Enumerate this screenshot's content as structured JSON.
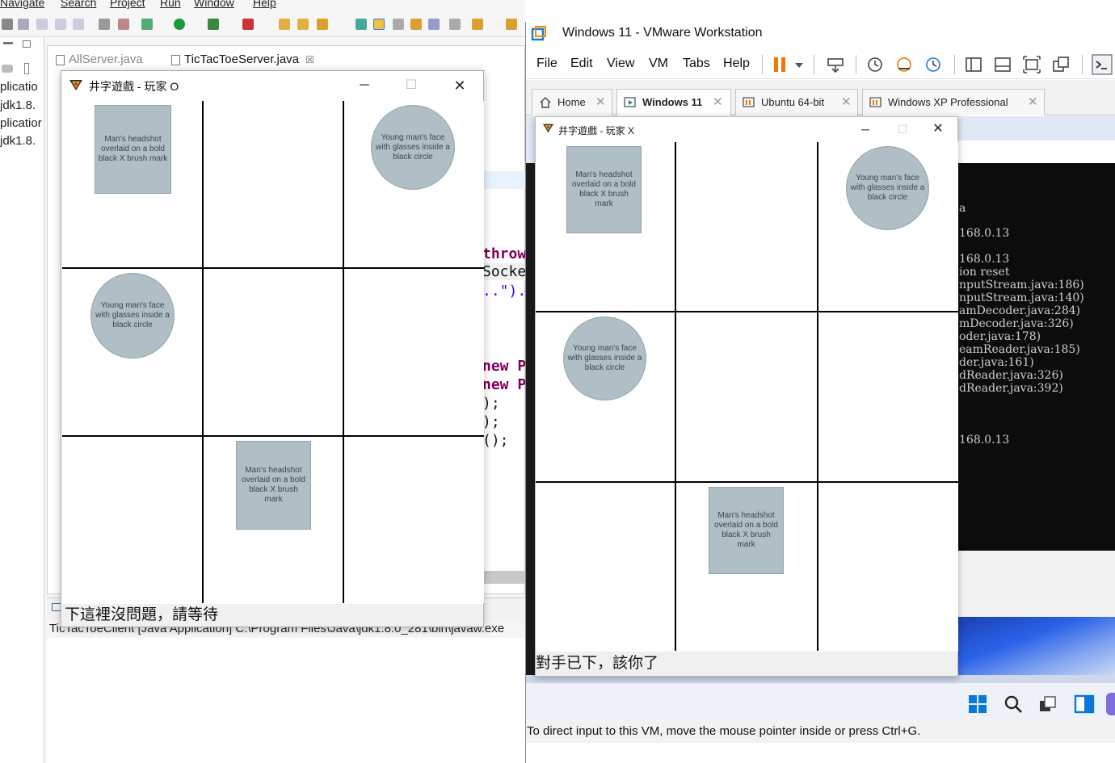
{
  "eclipse": {
    "menu": [
      "Navigate",
      "Search",
      "Project",
      "Run",
      "Window",
      "Help"
    ],
    "left_panel_lines": [
      "plicatio",
      "jdk1.8.",
      "plicatior",
      "jdk1.8."
    ],
    "editor_tabs": [
      {
        "label": "AllServer.java",
        "active": false
      },
      {
        "label": "TicTacToeServer.java",
        "active": true,
        "close": "☒"
      }
    ],
    "code_fragments": {
      "throw": "throw",
      "socke": "Socke",
      "dots": "..\").",
      "new1": "new P",
      "new2": "new P",
      "semi1": ");",
      "semi2": ");",
      "semi3": "();"
    },
    "console_title": "TicTacToeClient [Java Application] C:\\Program Files\\Java\\jdk1.8.0_281\\bin\\javaw.exe"
  },
  "host_game": {
    "title": "井字遊戲 - 玩家 O",
    "buttons": {
      "minimize": "─",
      "maximize": "☐",
      "close": "✕"
    },
    "board": [
      [
        "X",
        "",
        "O"
      ],
      [
        "O",
        "",
        ""
      ],
      [
        "",
        "X",
        ""
      ]
    ],
    "status": "下這裡沒問題，請等待"
  },
  "vmware": {
    "title": "Windows 11 - VMware Workstation",
    "menu": [
      "File",
      "Edit",
      "View",
      "VM",
      "Tabs",
      "Help"
    ],
    "tabs": [
      {
        "label": "Home",
        "active": false
      },
      {
        "label": "Windows 11",
        "active": true
      },
      {
        "label": "Ubuntu 64-bit",
        "active": false
      },
      {
        "label": "Windows XP Professional",
        "active": false
      }
    ],
    "tab_close": "✕",
    "console_lines": [
      "a",
      "168.0.13",
      "168.0.13",
      "ion reset",
      "nputStream.java:186)",
      "nputStream.java:140)",
      "amDecoder.java:284)",
      "mDecoder.java:326)",
      "oder.java:178)",
      "eamReader.java:185)",
      "der.java:161)",
      "dReader.java:326)",
      "dReader.java:392)",
      "168.0.13"
    ],
    "status_bar": "To direct input to this VM, move the mouse pointer inside or press Ctrl+G."
  },
  "guest_game": {
    "title": "井字遊戲 - 玩家 X",
    "buttons": {
      "minimize": "─",
      "maximize": "☐",
      "close": "✕"
    },
    "board": [
      [
        "X",
        "",
        "O"
      ],
      [
        "O",
        "",
        ""
      ],
      [
        "",
        "X",
        ""
      ]
    ],
    "status": "對手已下，該你了"
  },
  "images": {
    "x_piece": "Man's headshot overlaid on a bold black X brush mark",
    "o_piece": "Young man's face with glasses inside a black circle"
  }
}
